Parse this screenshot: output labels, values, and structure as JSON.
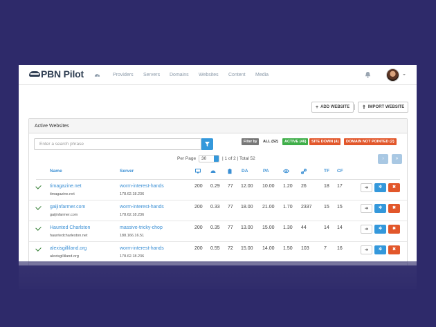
{
  "nav": {
    "logo": "PBN Pilot",
    "links": [
      "Providers",
      "Servers",
      "Domains",
      "Websites",
      "Content",
      "Media"
    ]
  },
  "actions": {
    "add_website": "ADD WEBSITE",
    "import_website": "IMPORT WEBSITE"
  },
  "panel": {
    "title": "Active Websites",
    "search_placeholder": "Enter a search phrase",
    "filter_label": "Filter by",
    "filters": [
      "ALL (52)",
      "ACTIVE (46)",
      "SITE DOWN (4)",
      "DOMAIN NOT POINTED (2)"
    ]
  },
  "pagination": {
    "per_page_label": "Per Page",
    "per_page_value": "30",
    "page_info": "| 1 of 2 | Total 52",
    "next": "›",
    "last": "»"
  },
  "table": {
    "headers": [
      "Name",
      "Server",
      "DA",
      "PA",
      "TF",
      "CF"
    ],
    "rows": [
      {
        "name": "timagazine.net",
        "domain": "timagazine.net",
        "server": "worm-interest-hands",
        "ip": "178.62.18.236",
        "status": "200",
        "c2": "0.29",
        "c3": "77",
        "da": "12.00",
        "pa": "10.00",
        "c6": "1.20",
        "links": "26",
        "tf": "18",
        "cf": "17"
      },
      {
        "name": "gaijinfarmer.com",
        "domain": "gaijinfarmer.com",
        "server": "worm-interest-hands",
        "ip": "178.62.18.236",
        "status": "200",
        "c2": "0.33",
        "c3": "77",
        "da": "18.00",
        "pa": "21.00",
        "c6": "1.70",
        "links": "2337",
        "tf": "15",
        "cf": "15"
      },
      {
        "name": "Haunted Charlston",
        "domain": "hauntedcharleston.net",
        "server": "massive-tricky-chop",
        "ip": "188.166.16.51",
        "status": "200",
        "c2": "0.35",
        "c3": "77",
        "da": "13.00",
        "pa": "15.00",
        "c6": "1.30",
        "links": "44",
        "tf": "14",
        "cf": "14"
      },
      {
        "name": "alexisgilliland.org",
        "domain": "alexisgilliland.org",
        "server": "worm-interest-hands",
        "ip": "178.62.18.236",
        "status": "200",
        "c2": "0.55",
        "c3": "72",
        "da": "15.00",
        "pa": "14.00",
        "c6": "1.50",
        "links": "103",
        "tf": "7",
        "cf": "16"
      }
    ]
  }
}
